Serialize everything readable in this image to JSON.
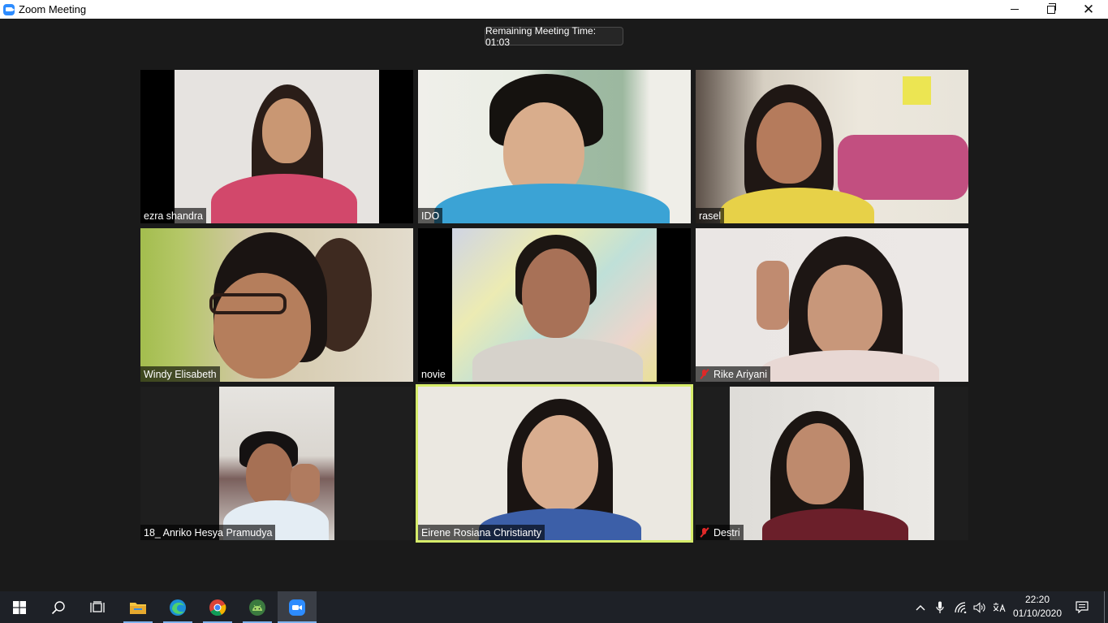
{
  "window": {
    "title": "Zoom Meeting"
  },
  "meeting": {
    "timer_text": "Remaining Meeting Time: 01:03",
    "participants": [
      {
        "name": "ezra shandra",
        "muted": false,
        "active_speaker": false
      },
      {
        "name": "IDO",
        "muted": false,
        "active_speaker": false
      },
      {
        "name": "rasel",
        "muted": false,
        "active_speaker": false
      },
      {
        "name": "Windy Elisabeth",
        "muted": false,
        "active_speaker": false
      },
      {
        "name": "novie",
        "muted": false,
        "active_speaker": false
      },
      {
        "name": "Rike Ariyani",
        "muted": true,
        "active_speaker": false
      },
      {
        "name": "18_ Anriko Hesya Pramudya",
        "muted": false,
        "active_speaker": false
      },
      {
        "name": "Eirene Rosiana Christianty",
        "muted": false,
        "active_speaker": true
      },
      {
        "name": "Destri",
        "muted": true,
        "active_speaker": false
      }
    ]
  },
  "taskbar": {
    "apps": [
      {
        "icon": "windows-start-icon"
      },
      {
        "icon": "search-icon"
      },
      {
        "icon": "task-view-icon"
      },
      {
        "icon": "file-explorer-icon"
      },
      {
        "icon": "edge-browser-icon"
      },
      {
        "icon": "chrome-browser-icon"
      },
      {
        "icon": "android-studio-icon"
      },
      {
        "icon": "zoom-app-icon"
      }
    ],
    "tray": {
      "time": "22:20",
      "date": "01/10/2020"
    }
  },
  "colors": {
    "background": "#1a1a1a",
    "active_speaker_border": "#d6ec6a",
    "zoom_blue": "#2d8cff",
    "muted_red": "#e02828"
  }
}
